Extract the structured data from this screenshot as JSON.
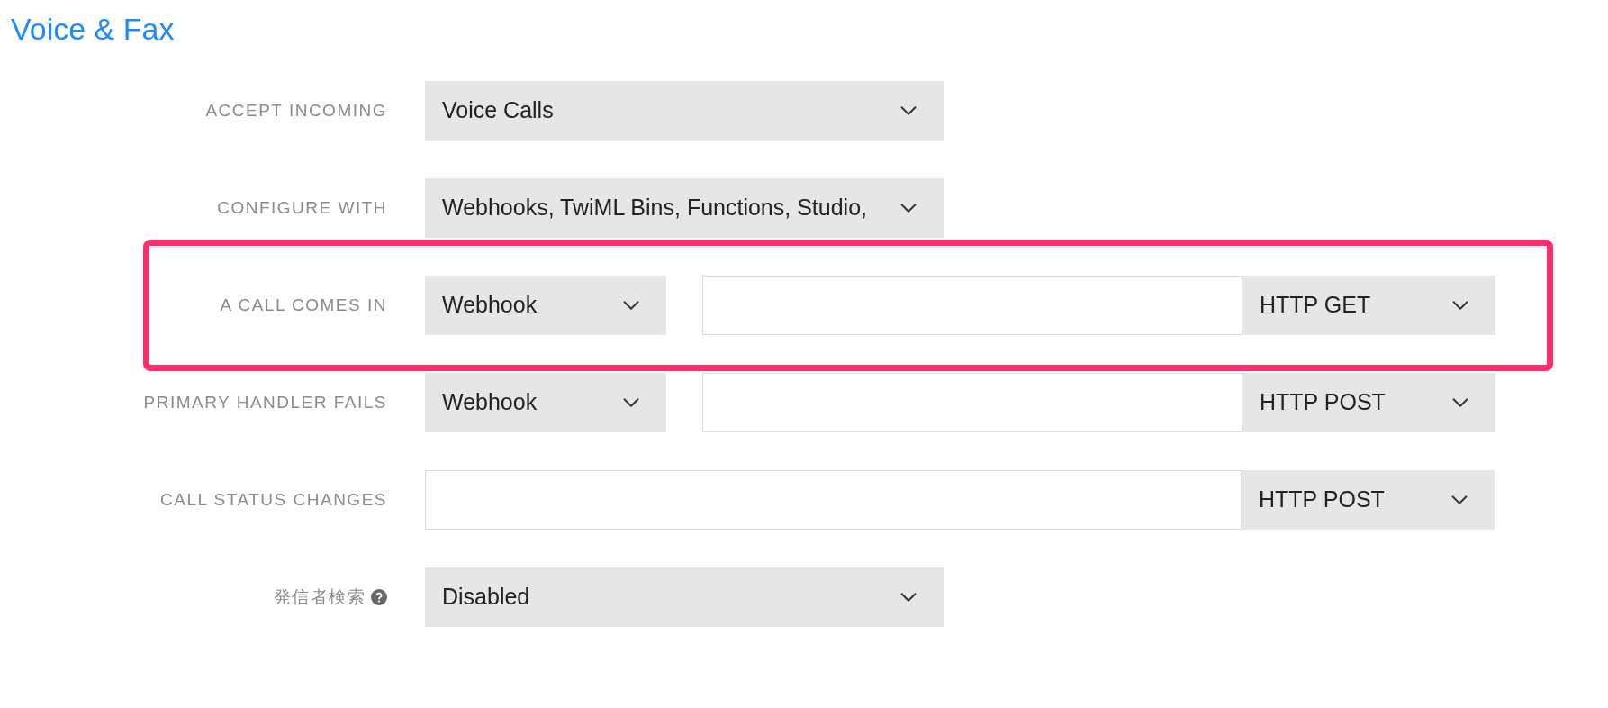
{
  "section_title": "Voice & Fax",
  "rows": [
    {
      "label": "ACCEPT INCOMING",
      "help_icon": false,
      "highlighted": false,
      "controls": [
        {
          "kind": "select",
          "value": "Voice Calls"
        }
      ]
    },
    {
      "label": "CONFIGURE WITH",
      "help_icon": false,
      "highlighted": false,
      "controls": [
        {
          "kind": "select",
          "value": "Webhooks, TwiML Bins, Functions, Studio,"
        }
      ]
    },
    {
      "label": "A CALL COMES IN",
      "help_icon": false,
      "highlighted": true,
      "controls": [
        {
          "kind": "select",
          "value": "Webhook"
        },
        {
          "kind": "url"
        },
        {
          "kind": "method",
          "value": "HTTP GET"
        }
      ]
    },
    {
      "label": "PRIMARY HANDLER FAILS",
      "help_icon": false,
      "highlighted": false,
      "controls": [
        {
          "kind": "select",
          "value": "Webhook"
        },
        {
          "kind": "url"
        },
        {
          "kind": "method",
          "value": "HTTP POST"
        }
      ]
    },
    {
      "label": "CALL STATUS CHANGES",
      "help_icon": false,
      "highlighted": false,
      "controls": [
        {
          "kind": "url"
        },
        {
          "kind": "method",
          "value": "HTTP POST"
        }
      ]
    },
    {
      "label": "発信者検索",
      "help_icon": true,
      "highlighted": false,
      "controls": [
        {
          "kind": "select",
          "value": "Disabled"
        }
      ]
    }
  ]
}
